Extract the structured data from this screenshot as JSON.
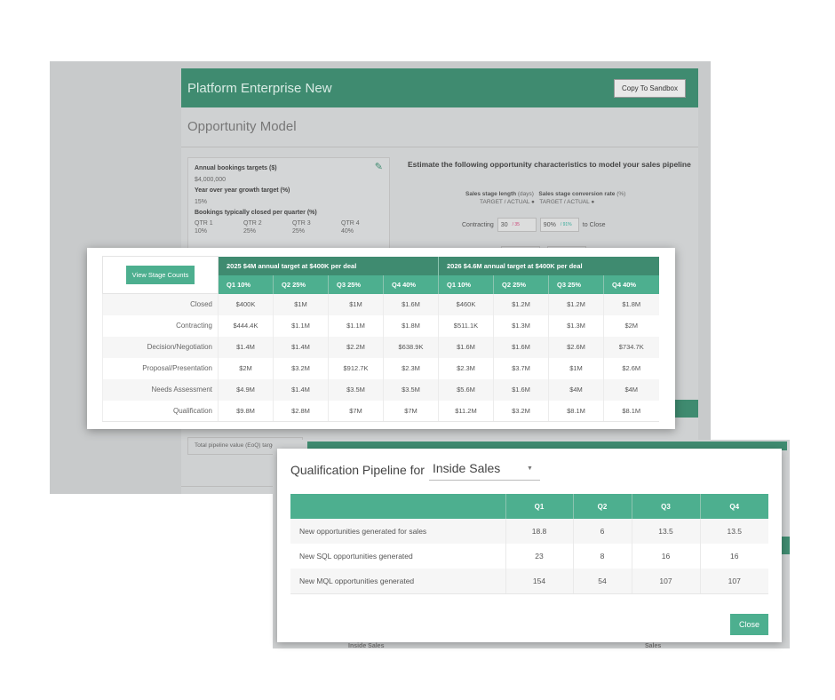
{
  "app": {
    "title": "Platform Enterprise New",
    "copy_button": "Copy To Sandbox",
    "subtitle": "Opportunity Model",
    "left_card": {
      "bookings_label": "Annual bookings targets ($)",
      "bookings_value": "$4,000,000",
      "growth_label": "Year over year growth target (%)",
      "growth_value": "15%",
      "per_quarter_label": "Bookings typically closed per quarter (%)",
      "quarters": [
        "QTR 1",
        "QTR 2",
        "QTR 3",
        "QTR 4"
      ],
      "quarter_values": [
        "10%",
        "25%",
        "25%",
        "40%"
      ]
    },
    "estimate_heading": "Estimate the following opportunity characteristics to model your sales pipeline",
    "stage_length_label": "Sales stage length",
    "stage_length_unit": "(days)",
    "conversion_label": "Sales stage conversion rate",
    "conversion_unit": "(%)",
    "target_actual": "TARGET / ACTUAL",
    "contracting_row": {
      "label": "Contracting",
      "days": "30",
      "days_actual": "/ 35",
      "rate": "90%",
      "rate_actual": "/ 91%",
      "suffix": "to Close"
    },
    "pipeline_label": "Total pipeline value (EoQ) target"
  },
  "stage_modal": {
    "view_button": "View Stage Counts",
    "group_2025": "2025 $4M annual target at $400K per deal",
    "group_2026": "2026 $4.6M annual target at $400K per deal",
    "quarters_2025": [
      "Q1 10%",
      "Q2 25%",
      "Q3 25%",
      "Q4 40%"
    ],
    "quarters_2026": [
      "Q1 10%",
      "Q2 25%",
      "Q3 25%",
      "Q4 40%"
    ],
    "rows": [
      {
        "stage": "Closed",
        "values": [
          "$400K",
          "$1M",
          "$1M",
          "$1.6M",
          "$460K",
          "$1.2M",
          "$1.2M",
          "$1.8M"
        ]
      },
      {
        "stage": "Contracting",
        "values": [
          "$444.4K",
          "$1.1M",
          "$1.1M",
          "$1.8M",
          "$511.1K",
          "$1.3M",
          "$1.3M",
          "$2M"
        ]
      },
      {
        "stage": "Decision/Negotiation",
        "values": [
          "$1.4M",
          "$1.4M",
          "$2.2M",
          "$638.9K",
          "$1.6M",
          "$1.6M",
          "$2.6M",
          "$734.7K"
        ]
      },
      {
        "stage": "Proposal/Presentation",
        "values": [
          "$2M",
          "$3.2M",
          "$912.7K",
          "$2.3M",
          "$2.3M",
          "$3.7M",
          "$1M",
          "$2.6M"
        ]
      },
      {
        "stage": "Needs Assessment",
        "values": [
          "$4.9M",
          "$1.4M",
          "$3.5M",
          "$3.5M",
          "$5.6M",
          "$1.6M",
          "$4M",
          "$4M"
        ]
      },
      {
        "stage": "Qualification",
        "values": [
          "$9.8M",
          "$2.8M",
          "$7M",
          "$7M",
          "$11.2M",
          "$3.2M",
          "$8.1M",
          "$8.1M"
        ]
      }
    ]
  },
  "qual_modal": {
    "title": "Qualification Pipeline for",
    "selected_team": "Inside Sales",
    "columns": [
      "",
      "Q1",
      "Q2",
      "Q3",
      "Q4"
    ],
    "rows": [
      {
        "label": "New opportunities generated for sales",
        "values": [
          "18.8",
          "6",
          "13.5",
          "13.5"
        ]
      },
      {
        "label": "New SQL opportunities generated",
        "values": [
          "23",
          "8",
          "16",
          "16"
        ]
      },
      {
        "label": "New MQL opportunities generated",
        "values": [
          "154",
          "54",
          "107",
          "107"
        ]
      }
    ],
    "close_button": "Close",
    "behind_left": "Inside Sales",
    "behind_right": "Sales"
  },
  "colors": {
    "brand_dark": "#3f8b70",
    "brand": "#4daf8f"
  }
}
